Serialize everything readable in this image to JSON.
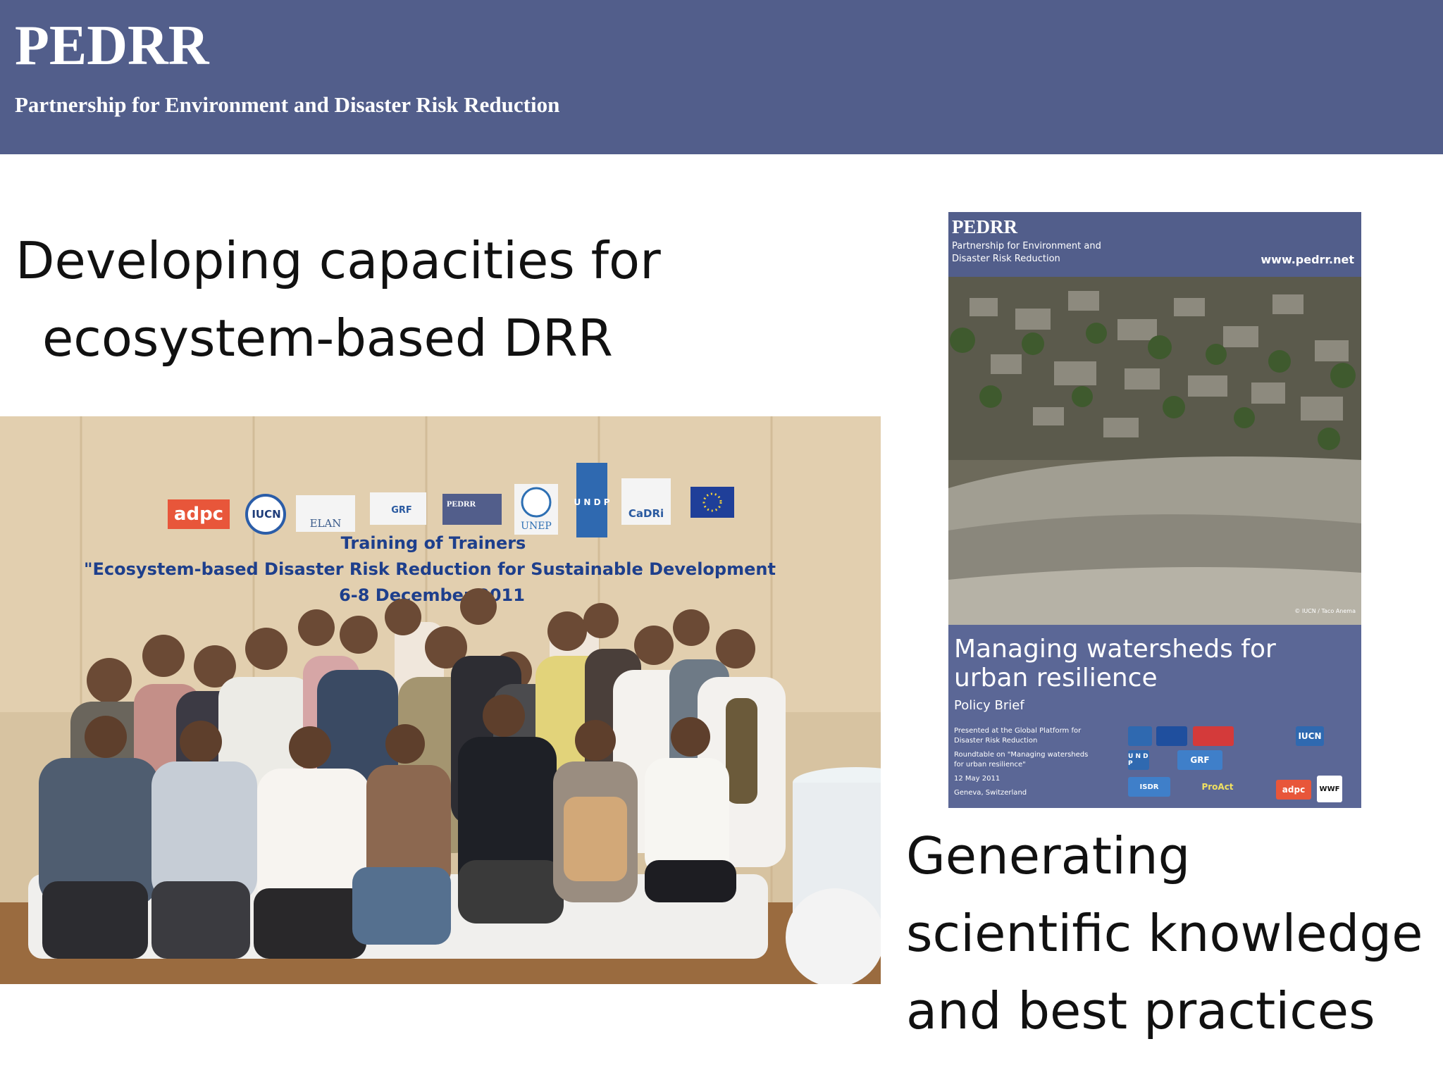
{
  "header": {
    "brand": "PEDRR",
    "subtitle": "Partnership for Environment and Disaster Risk Reduction"
  },
  "left": {
    "heading_line1": "Developing capacities for",
    "heading_line2": "ecosystem-based DRR",
    "photo": {
      "logos": [
        "adpc",
        "IUCN",
        "ELAN",
        "GRF",
        "PEDRR",
        "UNEP",
        "U N D P",
        "CaDRi"
      ],
      "banner_line1": "Training of Trainers",
      "banner_line2": "\"Ecosystem-based Disaster Risk Reduction for Sustainable Development",
      "banner_line3": "6-8 December 2011"
    }
  },
  "policy_brief": {
    "brand": "PEDRR",
    "brand_sub": "Partnership for Environment and Disaster Risk Reduction",
    "url": "www.pedrr.net",
    "credit": "© IUCN / Taco Anema",
    "title": "Managing watersheds for urban resilience",
    "subtitle": "Policy Brief",
    "notes": [
      "Presented at the Global Platform for Disaster Risk Reduction",
      "Roundtable on \"Managing watersheds for urban resilience\"",
      "12 May 2011",
      "Geneva, Switzerland"
    ],
    "logos": [
      "IUCN",
      "U N D P",
      "GRF",
      "ISDR",
      "ProAct",
      "adpc",
      "WWF"
    ]
  },
  "right": {
    "heading_line1": "Generating",
    "heading_line2": "scientific knowledge",
    "heading_line3": "and best practices"
  },
  "colors": {
    "header_bg": "#525e8b",
    "cover_bg": "#5b6796",
    "banner_text": "#1e3f8c",
    "adpc_orange": "#e8563a"
  }
}
